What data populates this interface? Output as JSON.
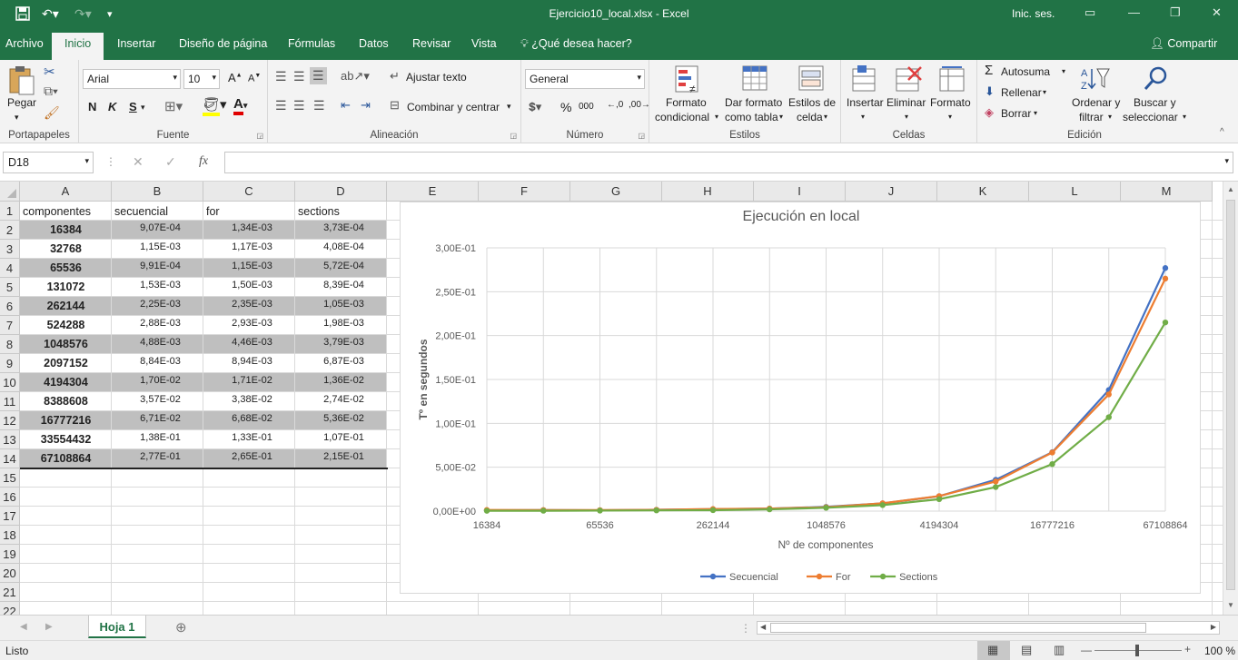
{
  "titlebar": {
    "title": "Ejercicio10_local.xlsx  -  Excel",
    "user": "Inic. ses."
  },
  "tabs": [
    "Archivo",
    "Inicio",
    "Insertar",
    "Diseño de página",
    "Fórmulas",
    "Datos",
    "Revisar",
    "Vista"
  ],
  "tell_me": "¿Qué desea hacer?",
  "share": "Compartir",
  "ribbon": {
    "clipboard": {
      "paste": "Pegar",
      "label": "Portapapeles"
    },
    "font": {
      "name": "Arial",
      "size": "10",
      "bold": "N",
      "italic": "K",
      "underline": "S",
      "label": "Fuente"
    },
    "alignment": {
      "wrap": "Ajustar texto",
      "merge": "Combinar y centrar",
      "label": "Alineación"
    },
    "number": {
      "format": "General",
      "label": "Número"
    },
    "styles": {
      "conditional_1": "Formato",
      "conditional_2": "condicional",
      "table_1": "Dar formato",
      "table_2": "como tabla",
      "cell_1": "Estilos de",
      "cell_2": "celda",
      "label": "Estilos"
    },
    "cells": {
      "insert": "Insertar",
      "delete": "Eliminar",
      "format": "Formato",
      "label": "Celdas"
    },
    "editing": {
      "autosum": "Autosuma",
      "fill": "Rellenar",
      "clear": "Borrar",
      "sort_1": "Ordenar y",
      "sort_2": "filtrar",
      "find_1": "Buscar y",
      "find_2": "seleccionar",
      "label": "Edición"
    }
  },
  "formula_bar": {
    "name_box": "D18",
    "fx": "fx",
    "value": ""
  },
  "sheet": {
    "columns": [
      "A",
      "B",
      "C",
      "D",
      "E",
      "F",
      "G",
      "H",
      "I",
      "J",
      "K",
      "L",
      "M"
    ],
    "rows": [
      "1",
      "2",
      "3",
      "4",
      "5",
      "6",
      "7",
      "8",
      "9",
      "10",
      "11",
      "12",
      "13",
      "14",
      "15",
      "16",
      "17",
      "18",
      "19",
      "20",
      "21",
      "22"
    ],
    "headers": [
      "componentes",
      "secuencial",
      "for",
      "sections"
    ],
    "data": [
      [
        "16384",
        "9,07E-04",
        "1,34E-03",
        "3,73E-04"
      ],
      [
        "32768",
        "1,15E-03",
        "1,17E-03",
        "4,08E-04"
      ],
      [
        "65536",
        "9,91E-04",
        "1,15E-03",
        "5,72E-04"
      ],
      [
        "131072",
        "1,53E-03",
        "1,50E-03",
        "8,39E-04"
      ],
      [
        "262144",
        "2,25E-03",
        "2,35E-03",
        "1,05E-03"
      ],
      [
        "524288",
        "2,88E-03",
        "2,93E-03",
        "1,98E-03"
      ],
      [
        "1048576",
        "4,88E-03",
        "4,46E-03",
        "3,79E-03"
      ],
      [
        "2097152",
        "8,84E-03",
        "8,94E-03",
        "6,87E-03"
      ],
      [
        "4194304",
        "1,70E-02",
        "1,71E-02",
        "1,36E-02"
      ],
      [
        "8388608",
        "3,57E-02",
        "3,38E-02",
        "2,74E-02"
      ],
      [
        "16777216",
        "6,71E-02",
        "6,68E-02",
        "5,36E-02"
      ],
      [
        "33554432",
        "1,38E-01",
        "1,33E-01",
        "1,07E-01"
      ],
      [
        "67108864",
        "2,77E-01",
        "2,65E-01",
        "2,15E-01"
      ]
    ]
  },
  "chart_data": {
    "type": "line",
    "title": "Ejecución en local",
    "xlabel": "Nº de componentes",
    "ylabel": "Tº en segundos",
    "categories": [
      "16384",
      "32768",
      "65536",
      "131072",
      "262144",
      "524288",
      "1048576",
      "2097152",
      "4194304",
      "8388608",
      "16777216",
      "33554432",
      "67108864"
    ],
    "x_tick_labels": [
      "16384",
      "65536",
      "262144",
      "1048576",
      "4194304",
      "16777216",
      "67108864"
    ],
    "y_tick_labels": [
      "0,00E+00",
      "5,00E-02",
      "1,00E-01",
      "1,50E-01",
      "2,00E-01",
      "2,50E-01",
      "3,00E-01"
    ],
    "ylim": [
      0,
      0.3
    ],
    "grid": true,
    "legend_position": "bottom",
    "series": [
      {
        "name": "Secuencial",
        "color": "#4472c4",
        "values": [
          0.000907,
          0.00115,
          0.000991,
          0.00153,
          0.00225,
          0.00288,
          0.00488,
          0.00884,
          0.017,
          0.0357,
          0.0671,
          0.138,
          0.277
        ]
      },
      {
        "name": "For",
        "color": "#ed7d31",
        "values": [
          0.00134,
          0.00117,
          0.00115,
          0.0015,
          0.00235,
          0.00293,
          0.00446,
          0.00894,
          0.0171,
          0.0338,
          0.0668,
          0.133,
          0.265
        ]
      },
      {
        "name": "Sections",
        "color": "#70ad47",
        "values": [
          0.000373,
          0.000408,
          0.000572,
          0.000839,
          0.00105,
          0.00198,
          0.00379,
          0.00687,
          0.0136,
          0.0274,
          0.0536,
          0.107,
          0.215
        ]
      }
    ]
  },
  "sheet_tab": "Hoja 1",
  "status": {
    "ready": "Listo",
    "zoom": "100 %"
  }
}
